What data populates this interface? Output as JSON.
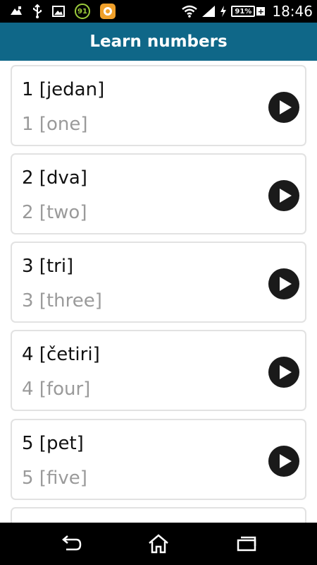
{
  "status_bar": {
    "left_icons": [
      "airplane-icon",
      "usb-icon",
      "image-icon",
      "notification-badge-icon",
      "app-ring-icon"
    ],
    "badge_number": "91",
    "battery_percent": "91%",
    "time": "18:46"
  },
  "header": {
    "title": "Learn numbers",
    "background_color": "#0f6788"
  },
  "items": [
    {
      "native": "1 [jedan]",
      "translation": "1 [one]"
    },
    {
      "native": "2 [dva]",
      "translation": "2 [two]"
    },
    {
      "native": "3 [tri]",
      "translation": "3 [three]"
    },
    {
      "native": "4 [četiri]",
      "translation": "4 [four]"
    },
    {
      "native": "5 [pet]",
      "translation": "5 [five]"
    }
  ],
  "navigation": {
    "buttons": [
      "back-icon",
      "home-icon",
      "recent-apps-icon"
    ]
  }
}
